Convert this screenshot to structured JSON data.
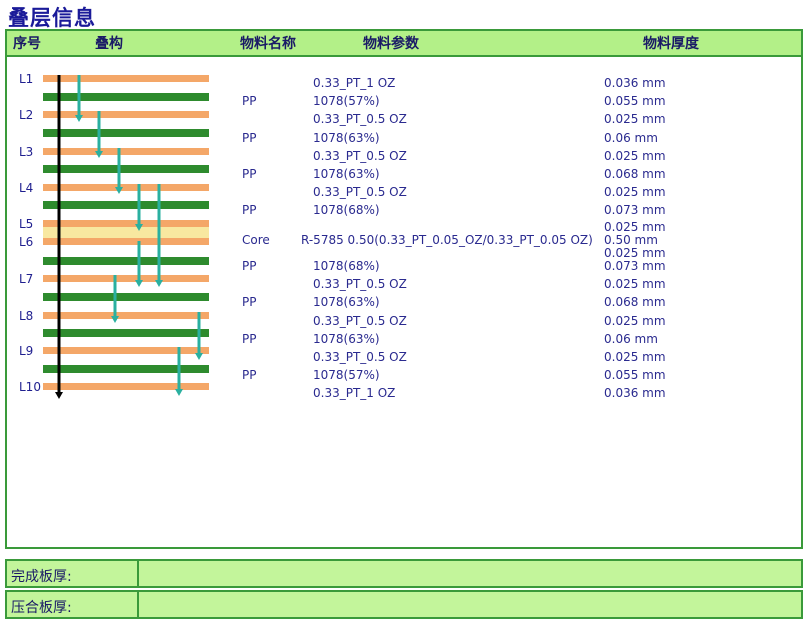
{
  "title": "叠层信息",
  "headers": {
    "seq": "序号",
    "stack": "叠构",
    "material_name": "物料名称",
    "material_param": "物料参数",
    "material_thickness": "物料厚度"
  },
  "colors": {
    "copper": "#f4a768",
    "dielectric": "#2e8b2e",
    "core": "#f8e8a0",
    "via_arrow": "#2ab0a0",
    "through_arrow": "#000000",
    "header_bg": "#b3f088",
    "border": "#3a9a3a"
  },
  "layer_labels": [
    "L1",
    "L2",
    "L3",
    "L4",
    "L5",
    "L6",
    "L7",
    "L8",
    "L9",
    "L10"
  ],
  "rows": [
    {
      "material": "",
      "param": "0.33_PT_1 OZ",
      "thickness": "0.036 mm"
    },
    {
      "material": "PP",
      "param": "1078(57%)",
      "thickness": "0.055 mm"
    },
    {
      "material": "",
      "param": "0.33_PT_0.5 OZ",
      "thickness": "0.025 mm"
    },
    {
      "material": "PP",
      "param": "1078(63%)",
      "thickness": "0.06 mm"
    },
    {
      "material": "",
      "param": "0.33_PT_0.5 OZ",
      "thickness": "0.025 mm"
    },
    {
      "material": "PP",
      "param": "1078(63%)",
      "thickness": "0.068 mm"
    },
    {
      "material": "",
      "param": "0.33_PT_0.5 OZ",
      "thickness": "0.025 mm"
    },
    {
      "material": "PP",
      "param": "1078(68%)",
      "thickness": "0.073 mm"
    },
    {
      "material": "",
      "param": "",
      "thickness": "0.025 mm"
    },
    {
      "material": "Core",
      "param": "R-5785 0.50(0.33_PT_0.05_OZ/0.33_PT_0.05 OZ)",
      "thickness": "0.50 mm"
    },
    {
      "material": "",
      "param": "",
      "thickness": "0.025 mm"
    },
    {
      "material": "PP",
      "param": "1078(68%)",
      "thickness": "0.073 mm"
    },
    {
      "material": "",
      "param": "0.33_PT_0.5 OZ",
      "thickness": "0.025 mm"
    },
    {
      "material": "PP",
      "param": "1078(63%)",
      "thickness": "0.068 mm"
    },
    {
      "material": "",
      "param": "0.33_PT_0.5 OZ",
      "thickness": "0.025 mm"
    },
    {
      "material": "PP",
      "param": "1078(63%)",
      "thickness": "0.06 mm"
    },
    {
      "material": "",
      "param": "0.33_PT_0.5 OZ",
      "thickness": "0.025 mm"
    },
    {
      "material": "PP",
      "param": "1078(57%)",
      "thickness": "0.055 mm"
    },
    {
      "material": "",
      "param": "0.33_PT_1 OZ",
      "thickness": "0.036 mm"
    }
  ],
  "footer": {
    "finished_label": "完成板厚:",
    "finished_value": "",
    "laminated_label": "压合板厚:",
    "laminated_value": ""
  }
}
